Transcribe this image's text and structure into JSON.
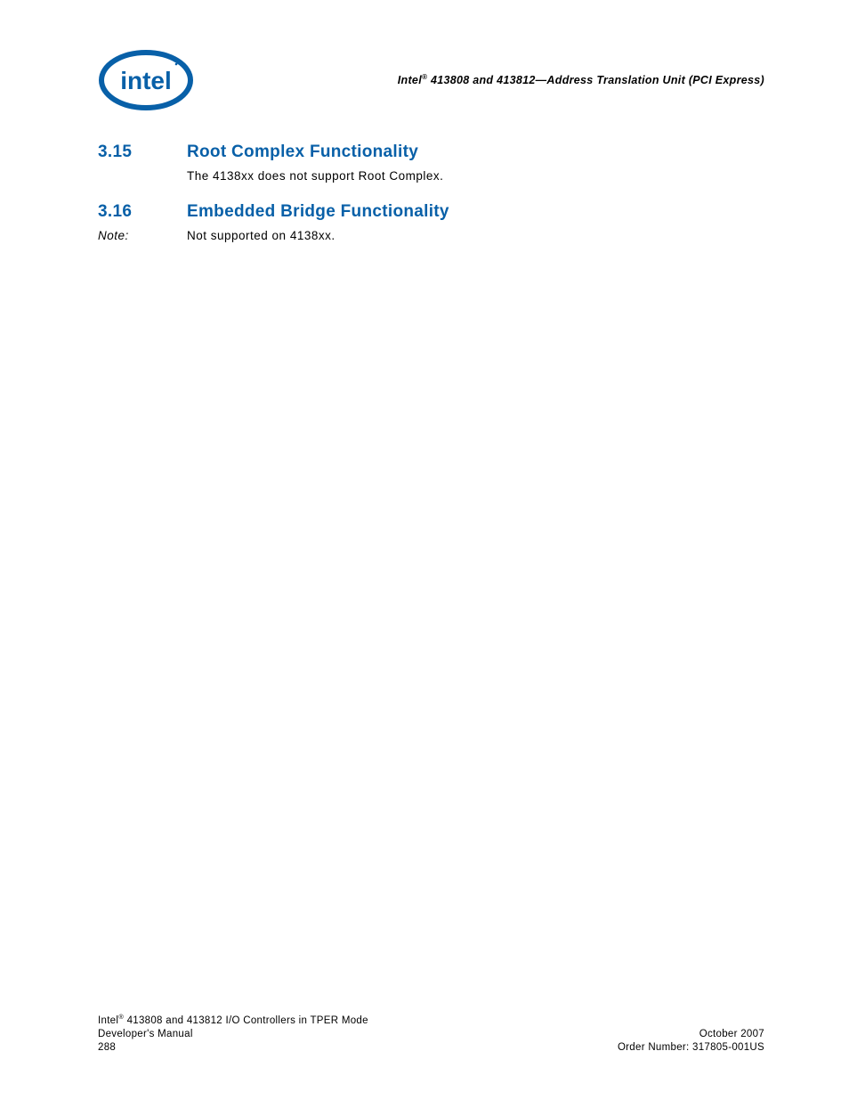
{
  "header": {
    "brand_prefix": "Intel",
    "reg": "®",
    "rest": " 413808 and 413812—Address Translation Unit (PCI Express)"
  },
  "sections": [
    {
      "num": "3.15",
      "title": "Root Complex Functionality",
      "note_label": "",
      "body": "The 4138xx does not support Root Complex."
    },
    {
      "num": "3.16",
      "title": "Embedded Bridge Functionality",
      "note_label": "Note:",
      "body": "Not supported on 4138xx."
    }
  ],
  "footer": {
    "left_line1a": "Intel",
    "left_line1_reg": "®",
    "left_line1b": " 413808 and 413812 I/O Controllers in TPER Mode",
    "left_line2": "Developer's Manual",
    "left_line3": "288",
    "right_line1": "October 2007",
    "right_line2": "Order Number: 317805-001US"
  }
}
